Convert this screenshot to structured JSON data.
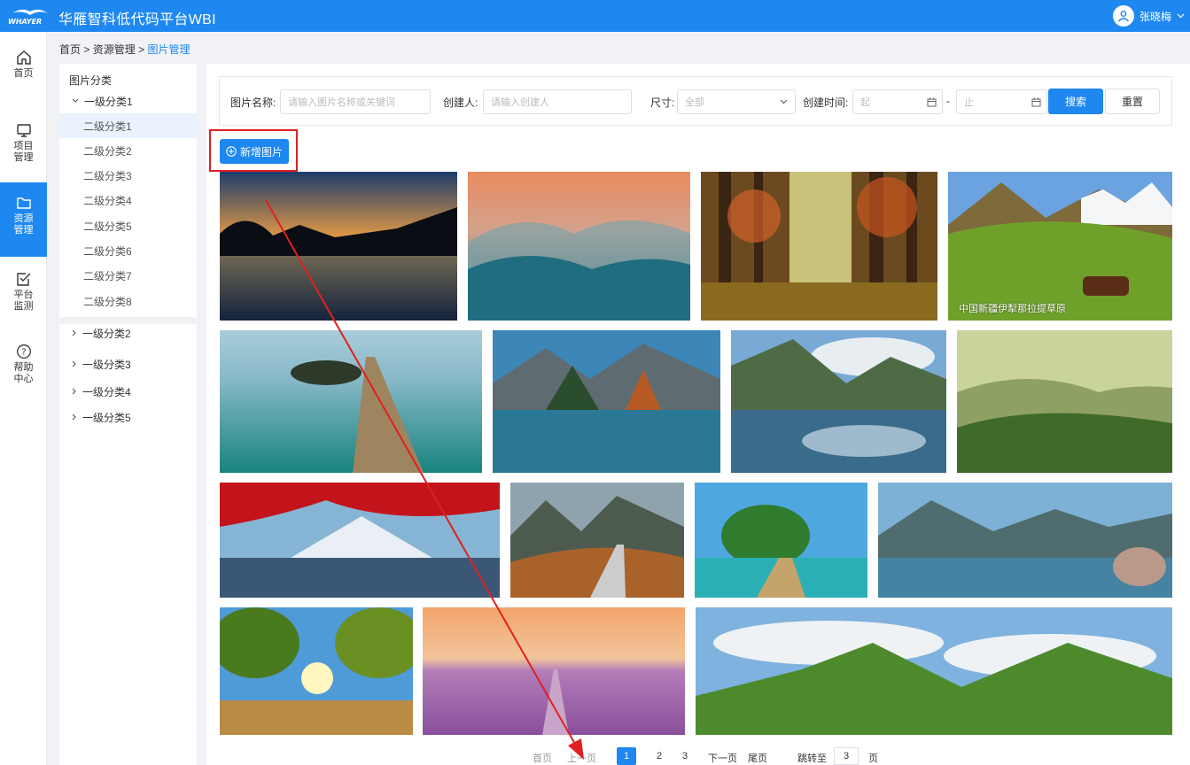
{
  "app": {
    "title": "华雁智科低代码平台WBI",
    "logo_text": "WHAYER",
    "user_name": "张晓梅"
  },
  "colors": {
    "brand": "#1e88f0",
    "annotation": "#e02020"
  },
  "nav": [
    {
      "label": "首页",
      "icon": "home-icon"
    },
    {
      "label": "项目\n管理",
      "icon": "monitor-icon"
    },
    {
      "label": "资源\n管理",
      "icon": "folder-icon",
      "active": true
    },
    {
      "label": "平台\n监测",
      "icon": "checklist-icon"
    },
    {
      "label": "帮助\n中心",
      "icon": "help-icon"
    }
  ],
  "breadcrumb": {
    "home": "首页",
    "sep": ">",
    "parent": "资源管理",
    "current": "图片管理"
  },
  "tree": {
    "title": "图片分类",
    "groups": [
      "一级分类1",
      "一级分类2",
      "一级分类3",
      "一级分类4",
      "一级分类5"
    ],
    "children": [
      "二级分类1",
      "二级分类2",
      "二级分类3",
      "二级分类4",
      "二级分类5",
      "二级分类6",
      "二级分类7",
      "二级分类8"
    ]
  },
  "filter": {
    "name_label": "图片名称:",
    "name_placeholder": "请输入图片名称或关键词",
    "creator_label": "创建人:",
    "creator_placeholder": "请输入创建人",
    "size_label": "尺寸:",
    "size_value": "全部",
    "time_label": "创建时间:",
    "start_placeholder": "起",
    "range_sep": "-",
    "end_placeholder": "止",
    "search": "搜索",
    "reset": "重置"
  },
  "add_button": "新增图片",
  "photo_caption": "中国新疆伊犁那拉提草原",
  "pager": {
    "first": "首页",
    "prev": "上一页",
    "pages": [
      "1",
      "2",
      "3"
    ],
    "next": "下一页",
    "last": "尾页",
    "jump_label": "跳转至",
    "jump_value": "3",
    "page_unit": "页"
  }
}
